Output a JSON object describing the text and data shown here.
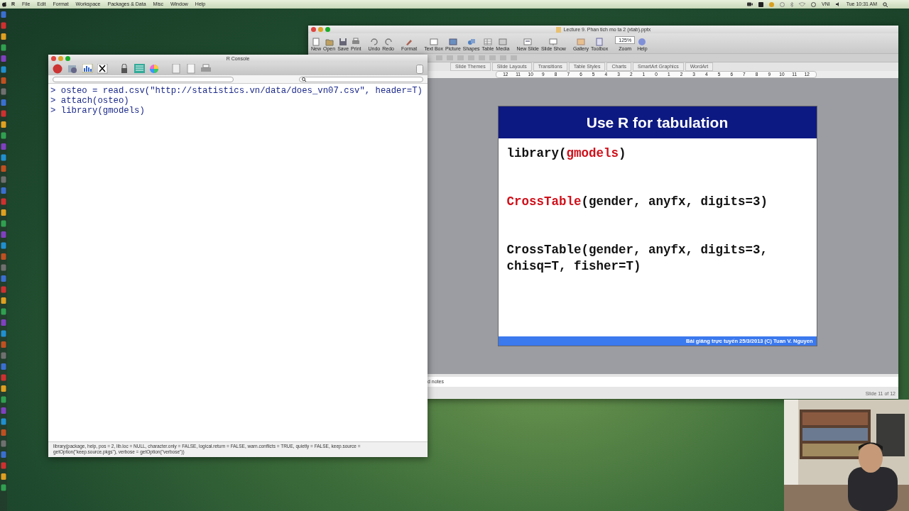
{
  "menubar": {
    "items": [
      "R",
      "File",
      "Edit",
      "Format",
      "Workspace",
      "Packages & Data",
      "Misc",
      "Window",
      "Help"
    ],
    "input_source": "VNI",
    "clock": "Tue 10:31 AM"
  },
  "powerpoint": {
    "title": "Lecture 9.  Phan tich mo ta 2 (xtab).pptx",
    "toolbar": [
      {
        "label": "New",
        "kind": "button"
      },
      {
        "label": "Open",
        "kind": "button"
      },
      {
        "label": "Save",
        "kind": "button"
      },
      {
        "label": "Print",
        "kind": "button"
      },
      {
        "label": "Undo",
        "kind": "button"
      },
      {
        "label": "Redo",
        "kind": "button"
      },
      {
        "label": "Format",
        "kind": "button"
      },
      {
        "label": "Text Box",
        "kind": "button"
      },
      {
        "label": "Picture",
        "kind": "button"
      },
      {
        "label": "Shapes",
        "kind": "button"
      },
      {
        "label": "Table",
        "kind": "button"
      },
      {
        "label": "Media",
        "kind": "button"
      },
      {
        "label": "New Slide",
        "kind": "button"
      },
      {
        "label": "Slide Show",
        "kind": "button"
      },
      {
        "label": "Gallery",
        "kind": "button"
      },
      {
        "label": "Toolbox",
        "kind": "button"
      },
      {
        "label": "Zoom",
        "kind": "zoom",
        "value": "125%"
      },
      {
        "label": "Help",
        "kind": "button"
      }
    ],
    "ribbon_tabs": [
      "Slide Themes",
      "Slide Layouts",
      "Transitions",
      "Table Styles",
      "Charts",
      "SmartArt Graphics",
      "WordArt"
    ],
    "ruler": [
      "12",
      "11",
      "10",
      "9",
      "8",
      "7",
      "6",
      "5",
      "4",
      "3",
      "2",
      "1",
      "0",
      "1",
      "2",
      "3",
      "4",
      "5",
      "6",
      "7",
      "8",
      "9",
      "10",
      "11",
      "12"
    ],
    "slide": {
      "title": "Use R for tabulation",
      "code_blocks": [
        [
          [
            {
              "text": "library("
            },
            {
              "text": "gmodels",
              "color": "#d0101a"
            },
            {
              "text": ")"
            }
          ]
        ],
        [
          [
            {
              "text": "CrossTable",
              "color": "#d0101a"
            },
            {
              "text": "(gender, anyfx, digits=3)"
            }
          ]
        ],
        [
          [
            {
              "text": "CrossTable(gender, anyfx, digits=3,"
            }
          ],
          [
            {
              "text": "chisq=T, fisher=T)"
            }
          ]
        ]
      ],
      "footer": "Bài giảng trực tuyến 25/3/2013  (C) Tuan V. Nguyen"
    },
    "notes": "d notes",
    "status": "Slide 11 of 12"
  },
  "r_console": {
    "title": "R Console",
    "lines": [
      {
        "prompt": ">",
        "text": "osteo = read.csv(\"http://statistics.vn/data/does_vn07.csv\", header=T)"
      },
      {
        "prompt": ">",
        "text": "attach(osteo)"
      },
      {
        "prompt": ">",
        "text": "library(gmodels)"
      }
    ],
    "status_line": "library(package, help, pos = 2, lib.loc = NULL, character.only = FALSE, logical.return = FALSE, warn.conflicts = TRUE, quietly = FALSE, keep.source = getOption(\"keep.source.pkgs\"), verbose = getOption(\"verbose\"))"
  }
}
